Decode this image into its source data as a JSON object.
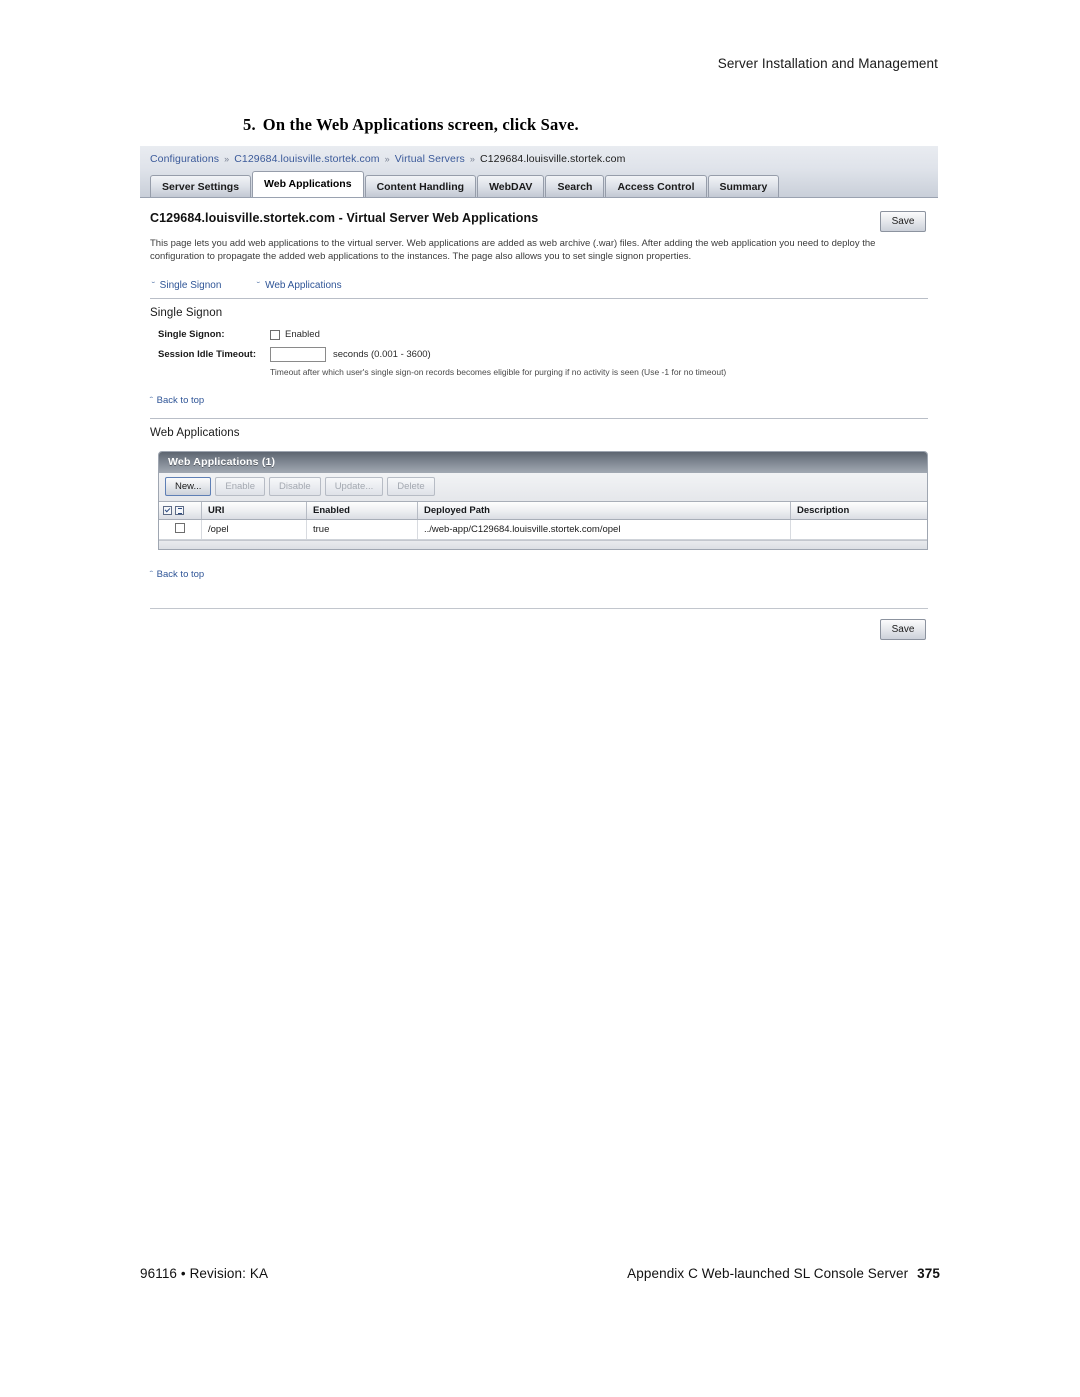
{
  "page": {
    "running_header": "Server Installation and Management",
    "step_number": "5.",
    "step_text": "On the Web Applications screen, click Save.",
    "footer_left": "96116 • Revision: KA",
    "footer_right": "Appendix C Web-launched SL Console Server",
    "footer_page": "375"
  },
  "screenshot": {
    "breadcrumb": {
      "items": [
        {
          "label": "Configurations",
          "link": true
        },
        {
          "label": "C129684.louisville.stortek.com",
          "link": true
        },
        {
          "label": "Virtual Servers",
          "link": true
        },
        {
          "label": "C129684.louisville.stortek.com",
          "link": false
        }
      ],
      "separator": "»"
    },
    "tabs": [
      {
        "label": "Server Settings",
        "active": false
      },
      {
        "label": "Web Applications",
        "active": true
      },
      {
        "label": "Content Handling",
        "active": false
      },
      {
        "label": "WebDAV",
        "active": false
      },
      {
        "label": "Search",
        "active": false
      },
      {
        "label": "Access Control",
        "active": false
      },
      {
        "label": "Summary",
        "active": false
      }
    ],
    "page_title": "C129684.louisville.stortek.com - Virtual Server Web Applications",
    "save_top_label": "Save",
    "save_bottom_label": "Save",
    "intro": "This page lets you add web applications to the virtual server. Web applications are added as web archive (.war) files. After adding the web application you need to deploy the configuration to propagate the added web applications to the instances. The page also allows you to set single signon properties.",
    "anchors": [
      {
        "label": "Single Signon",
        "glyph": "ˇ"
      },
      {
        "label": "Web Applications",
        "glyph": "ˇ"
      }
    ],
    "single_signon": {
      "section_title": "Single Signon",
      "enabled_label": "Single Signon:",
      "enabled_checkbox_label": "Enabled",
      "enabled_checked": false,
      "timeout_label": "Session Idle Timeout:",
      "timeout_value": "",
      "timeout_units": "seconds (0.001 - 3600)",
      "timeout_hint": "Timeout after which user's single sign-on records becomes eligible for purging if no activity is seen (Use -1 for no timeout)",
      "back_to_top": "Back to top"
    },
    "web_applications": {
      "section_title": "Web Applications",
      "panel_title": "Web Applications (1)",
      "toolbar": [
        {
          "label": "New...",
          "disabled": false,
          "primary": true
        },
        {
          "label": "Enable",
          "disabled": true,
          "primary": false
        },
        {
          "label": "Disable",
          "disabled": true,
          "primary": false
        },
        {
          "label": "Update...",
          "disabled": true,
          "primary": false
        },
        {
          "label": "Delete",
          "disabled": true,
          "primary": false
        }
      ],
      "columns": [
        "URI",
        "Enabled",
        "Deployed Path",
        "Description"
      ],
      "rows": [
        {
          "checked": false,
          "uri": "/opel",
          "enabled": "true",
          "deployed_path": "../web-app/C129684.louisville.stortek.com/opel",
          "description": ""
        }
      ],
      "back_to_top": "Back to top"
    }
  },
  "colors": {
    "link": "#2f5597",
    "panel_header_dark": "#5d6570",
    "chrome": "#dfe3ea"
  }
}
